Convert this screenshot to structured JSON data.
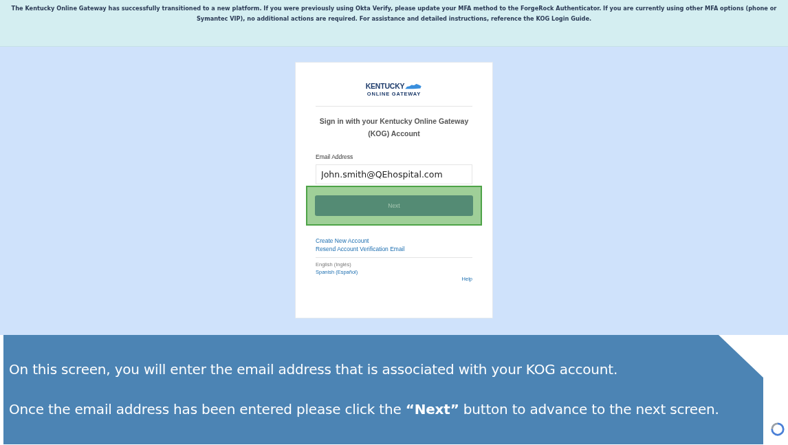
{
  "banner": {
    "text": "The Kentucky Online Gateway has successfully transitioned to a new platform. If you were previously using Okta Verify, please update your MFA method to the ForgeRock Authenticator. If you are currently using other MFA options (phone or Symantec VIP), no additional actions are required. For assistance and detailed instructions, reference the KOG Login Guide."
  },
  "logo": {
    "line_1": "KENTUCKY",
    "line_2": "ONLINE GATEWAY"
  },
  "login": {
    "heading": "Sign in with your Kentucky Online Gateway (KOG) Account",
    "email_label": "Email Address",
    "email_value": "John.smith@QEhospital.com",
    "next_button": "Next",
    "highlighted": true
  },
  "links": [
    "Create New Account",
    "Resend Account Verification Email"
  ],
  "languages": [
    {
      "label": "English (Inglés)",
      "selected": true
    },
    {
      "label": "Spanish (Español)",
      "selected": false
    }
  ],
  "help": "Help",
  "callout": {
    "lines": [
      "On this  screen, you will enter the email address that is associated with your KOG account.",
      "Once the email address has been entered please click the **“Next”** button to advance to the next screen."
    ]
  }
}
